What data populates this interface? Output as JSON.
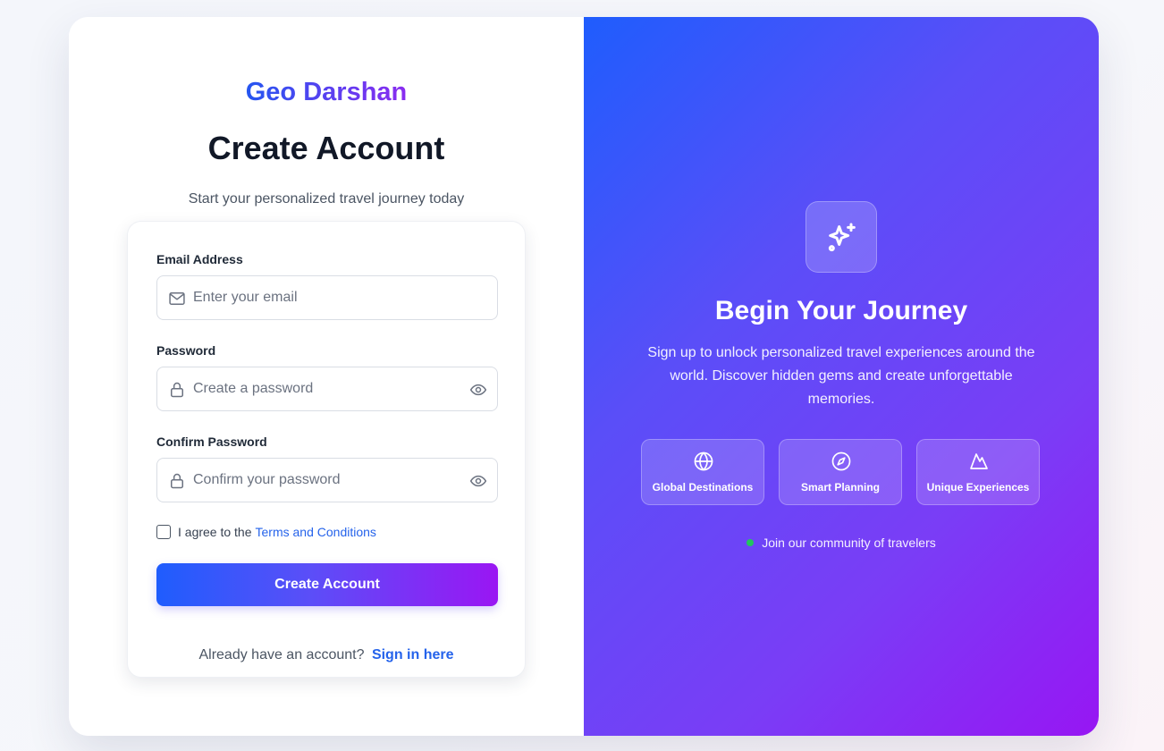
{
  "brand": "Geo Darshan",
  "form_panel": {
    "title": "Create Account",
    "subtitle": "Start your personalized travel journey today",
    "email": {
      "label": "Email Address",
      "placeholder": "Enter your email",
      "icon": "mail-icon"
    },
    "password": {
      "label": "Password",
      "placeholder": "Create a password",
      "icon": "lock-icon"
    },
    "confirm_password": {
      "label": "Confirm Password",
      "placeholder": "Confirm your password",
      "icon": "lock-icon"
    },
    "agree_text": "I agree to the",
    "terms_link": "Terms and Conditions",
    "submit_label": "Create Account",
    "signin_prompt": "Already have an account?",
    "signin_link": "Sign in here"
  },
  "promo_panel": {
    "icon": "sparkles-icon",
    "title": "Begin Your Journey",
    "description": "Sign up to unlock personalized travel experiences around the world. Discover hidden gems and create unforgettable memories.",
    "features": [
      {
        "label": "Global Destinations",
        "icon": "globe-icon"
      },
      {
        "label": "Smart Planning",
        "icon": "compass-icon"
      },
      {
        "label": "Unique Experiences",
        "icon": "mountain-icon"
      }
    ],
    "community_text": "Join our community of travelers"
  },
  "colors": {
    "accent_blue": "#1f5dfd",
    "accent_purple": "#9716f3",
    "link": "#2563eb",
    "status_dot": "#22c55e"
  }
}
